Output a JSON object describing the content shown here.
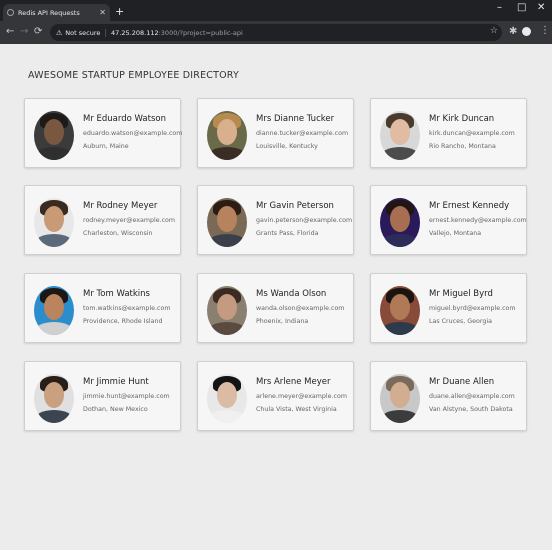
{
  "browser": {
    "tab_title": "Redis API Requests",
    "security_label": "Not secure",
    "url_host": "47.25.208.112",
    "url_path": ":3000/?project=public-api",
    "new_tab_symbol": "+",
    "minimize_symbol": "–",
    "maximize_symbol": "□",
    "close_symbol": "✕"
  },
  "page": {
    "heading": "AWESOME STARTUP EMPLOYEE DIRECTORY"
  },
  "employees": [
    {
      "name": "Mr Eduardo Watson",
      "email": "eduardo.watson@example.com",
      "location": "Auburn, Maine",
      "skin": "#7a5740",
      "hair": "#1e1a18",
      "shirt": "#2f2f2f",
      "bg": "#3b3b3b"
    },
    {
      "name": "Mrs Dianne Tucker",
      "email": "dianne.tucker@example.com",
      "location": "Louisville, Kentucky",
      "skin": "#d8b08e",
      "hair": "#b78a4e",
      "shirt": "#3a2d25",
      "bg": "#6a6a4a"
    },
    {
      "name": "Mr Kirk Duncan",
      "email": "kirk.duncan@example.com",
      "location": "Rio Rancho, Montana",
      "skin": "#e1bca3",
      "hair": "#4a3a2e",
      "shirt": "#4c4c4c",
      "bg": "#d8d8d8"
    },
    {
      "name": "Mr Rodney Meyer",
      "email": "rodney.meyer@example.com",
      "location": "Charleston, Wisconsin",
      "skin": "#c89a76",
      "hair": "#3b2a1f",
      "shirt": "#5a6a7a",
      "bg": "#e8e8e8"
    },
    {
      "name": "Mr Gavin Peterson",
      "email": "gavin.peterson@example.com",
      "location": "Grants Pass, Florida",
      "skin": "#b7835e",
      "hair": "#2b1c14",
      "shirt": "#3a3f4a",
      "bg": "#7a6a55"
    },
    {
      "name": "Mr Ernest Kennedy",
      "email": "ernest.kennedy@example.com",
      "location": "Vallejo, Montana",
      "skin": "#a86e52",
      "hair": "#201612",
      "shirt": "#2c2c5a",
      "bg": "#2a1a5a"
    },
    {
      "name": "Mr Tom Watkins",
      "email": "tom.watkins@example.com",
      "location": "Providence, Rhode Island",
      "skin": "#b9845e",
      "hair": "#1e1714",
      "shirt": "#d0d0d0",
      "bg": "#2c8dcc"
    },
    {
      "name": "Ms Wanda Olson",
      "email": "wanda.olson@example.com",
      "location": "Phoenix, Indiana",
      "skin": "#c49a80",
      "hair": "#3b2b22",
      "shirt": "#5a4a40",
      "bg": "#8a8070"
    },
    {
      "name": "Mr Miguel Byrd",
      "email": "miguel.byrd@example.com",
      "location": "Las Cruces, Georgia",
      "skin": "#b07a58",
      "hair": "#1c1410",
      "shirt": "#2c3a4c",
      "bg": "#8a4a3a"
    },
    {
      "name": "Mr Jimmie Hunt",
      "email": "jimmie.hunt@example.com",
      "location": "Dothan, New Mexico",
      "skin": "#c9a080",
      "hair": "#2a1f18",
      "shirt": "#3b4550",
      "bg": "#e0e0e0"
    },
    {
      "name": "Mrs Arlene Meyer",
      "email": "arlene.meyer@example.com",
      "location": "Chula Vista, West Virginia",
      "skin": "#dcbba4",
      "hair": "#141414",
      "shirt": "#f0f0f0",
      "bg": "#e8e8e8"
    },
    {
      "name": "Mr Duane Allen",
      "email": "duane.allen@example.com",
      "location": "Van Alstyne, South Dakota",
      "skin": "#d2ad90",
      "hair": "#7a6a5a",
      "shirt": "#3c3c3c",
      "bg": "#c8c8c8"
    }
  ]
}
